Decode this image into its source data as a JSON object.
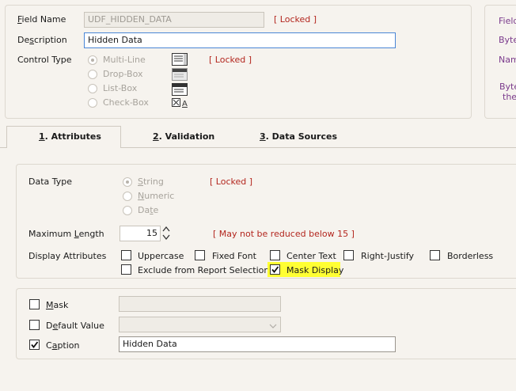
{
  "field_name": {
    "label": "Field Name",
    "value": "UDF_HIDDEN_DATA",
    "locked": "[ Locked ]"
  },
  "description": {
    "label": "Description",
    "value": "Hidden Data"
  },
  "control_type": {
    "label": "Control Type",
    "options": [
      "Multi-Line",
      "Drop-Box",
      "List-Box",
      "Check-Box"
    ],
    "selected": "Multi-Line",
    "locked": "[ Locked ]"
  },
  "right_panel": {
    "field": "Field",
    "byte": "Byte",
    "nam": "Nam",
    "byte2": "Byte",
    "the": "the"
  },
  "tabs": [
    {
      "label": "1. Attributes",
      "active": true
    },
    {
      "label": "2. Validation",
      "active": false
    },
    {
      "label": "3. Data Sources",
      "active": false
    }
  ],
  "data_type": {
    "label": "Data Type",
    "options": [
      "String",
      "Numeric",
      "Date"
    ],
    "selected": "String",
    "locked": "[ Locked ]"
  },
  "max_length": {
    "label": "Maximum Length",
    "value": "15",
    "note": "[ May not be reduced below 15 ]"
  },
  "display_attributes": {
    "label": "Display Attributes",
    "options": [
      {
        "label": "Uppercase",
        "checked": false
      },
      {
        "label": "Fixed Font",
        "checked": false
      },
      {
        "label": "Center Text",
        "checked": false
      },
      {
        "label": "Right-Justify",
        "checked": false
      },
      {
        "label": "Borderless",
        "checked": false
      },
      {
        "label": "Exclude from Report Selection",
        "checked": false
      },
      {
        "label": "Mask Display",
        "checked": true,
        "highlight": "#ffff33"
      }
    ]
  },
  "mask": {
    "label": "Mask",
    "checked": false,
    "value": ""
  },
  "default_value": {
    "label": "Default Value",
    "checked": false,
    "value": ""
  },
  "caption": {
    "label": "Caption",
    "checked": true,
    "value": "Hidden Data"
  },
  "colors": {
    "background": "#f6f3ee",
    "locked": "#b3261e",
    "focus_border": "#4a86d6",
    "highlight": "#ffff33"
  }
}
